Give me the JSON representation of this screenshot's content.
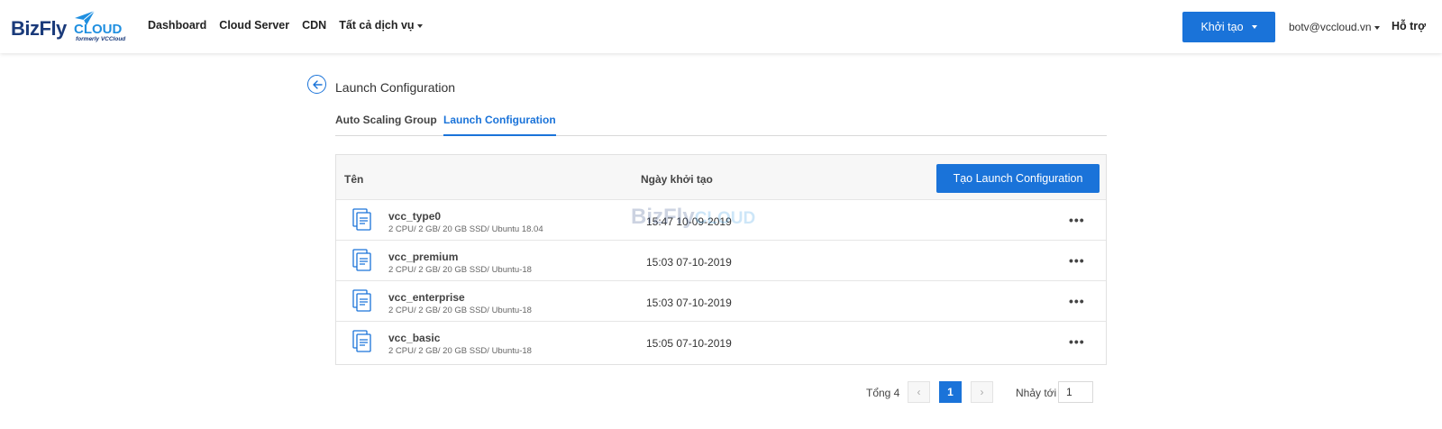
{
  "brand": {
    "name_part1": "BizFly",
    "name_part2": "CLOUD",
    "tagline": "formerly VCCloud"
  },
  "nav": {
    "links": [
      "Dashboard",
      "Cloud Server",
      "CDN",
      "Tất cả dịch vụ"
    ],
    "create_label": "Khởi tạo",
    "user_email": "botv@vccloud.vn",
    "help_label": "Hỗ trợ"
  },
  "page": {
    "title": "Launch Configuration",
    "tabs": [
      {
        "label": "Auto Scaling Group",
        "active": false
      },
      {
        "label": "Launch Configuration",
        "active": true
      }
    ]
  },
  "table": {
    "columns": {
      "name": "Tên",
      "created": "Ngày khởi tạo"
    },
    "add_button_label": "Tạo Launch Configuration",
    "rows": [
      {
        "name": "vcc_type0",
        "spec": "2 CPU/ 2 GB/ 20 GB SSD/ Ubuntu 18.04",
        "created": "15:47 10-09-2019"
      },
      {
        "name": "vcc_premium",
        "spec": "2 CPU/ 2 GB/ 20 GB SSD/ Ubuntu-18",
        "created": "15:03 07-10-2019"
      },
      {
        "name": "vcc_enterprise",
        "spec": "2 CPU/ 2 GB/ 20 GB SSD/ Ubuntu-18",
        "created": "15:03 07-10-2019"
      },
      {
        "name": "vcc_basic",
        "spec": "2 CPU/ 2 GB/ 20 GB SSD/ Ubuntu-18",
        "created": "15:05 07-10-2019"
      }
    ],
    "more_label": "•••"
  },
  "pagination": {
    "total_label": "Tổng 4",
    "prev": "‹",
    "current_page": "1",
    "next": "›",
    "jump_label": "Nhảy tới",
    "jump_value": "1"
  },
  "colors": {
    "accent": "#1a73d9",
    "brand_dark": "#1a3a7a",
    "brand_light": "#1f8fe0"
  },
  "icons": {
    "back": "arrow-left-circle-icon",
    "row": "config-file-icon",
    "more": "more-horizontal-icon",
    "caret": "caret-down-icon"
  }
}
